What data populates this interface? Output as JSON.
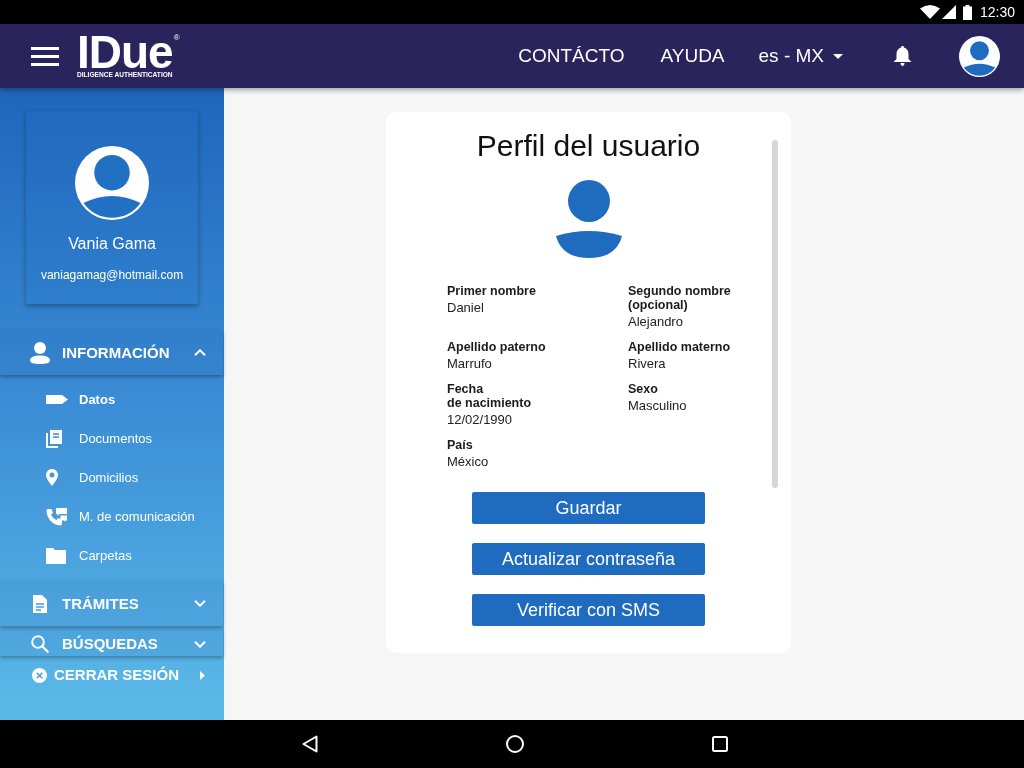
{
  "status_bar": {
    "time": "12:30"
  },
  "header": {
    "logo": {
      "wordmark": "IDue",
      "mark": "®",
      "tagline": "DILIGENCE AUTHENTICATION"
    },
    "nav_links": [
      "CONTÁCTO",
      "AYUDA"
    ],
    "language": "es - MX"
  },
  "sidebar": {
    "profile": {
      "name": "Vania Gama",
      "email": "vaniagamag@hotmail.com"
    },
    "sections": [
      {
        "label": "INFORMACIÓN",
        "expanded": true,
        "items": [
          {
            "label": "Datos",
            "selected": true
          },
          {
            "label": "Documentos",
            "selected": false
          },
          {
            "label": "Domicilios",
            "selected": false
          },
          {
            "label": "M. de comunicación",
            "selected": false
          },
          {
            "label": "Carpetas",
            "selected": false
          }
        ]
      },
      {
        "label": "TRÁMITES",
        "expanded": false
      },
      {
        "label": "BÚSQUEDAS",
        "expanded": false
      }
    ],
    "logout": "CERRAR SESIÓN"
  },
  "profile_card": {
    "title": "Perfil del usuario",
    "fields": [
      {
        "label": "Primer nombre",
        "value": "Daniel"
      },
      {
        "label": "Segundo nombre\n(opcional)",
        "value": "Alejandro"
      },
      {
        "label": "Apellido paterno",
        "value": "Marrufo"
      },
      {
        "label": "Apellido materno",
        "value": "Rivera"
      },
      {
        "label": "Fecha\nde nacimiento",
        "value": "12/02/1990"
      },
      {
        "label": "Sexo",
        "value": "Masculino"
      },
      {
        "label": "País",
        "value": "México"
      }
    ],
    "buttons": [
      "Guardar",
      "Actualizar contraseña",
      "Verificar con SMS"
    ]
  }
}
